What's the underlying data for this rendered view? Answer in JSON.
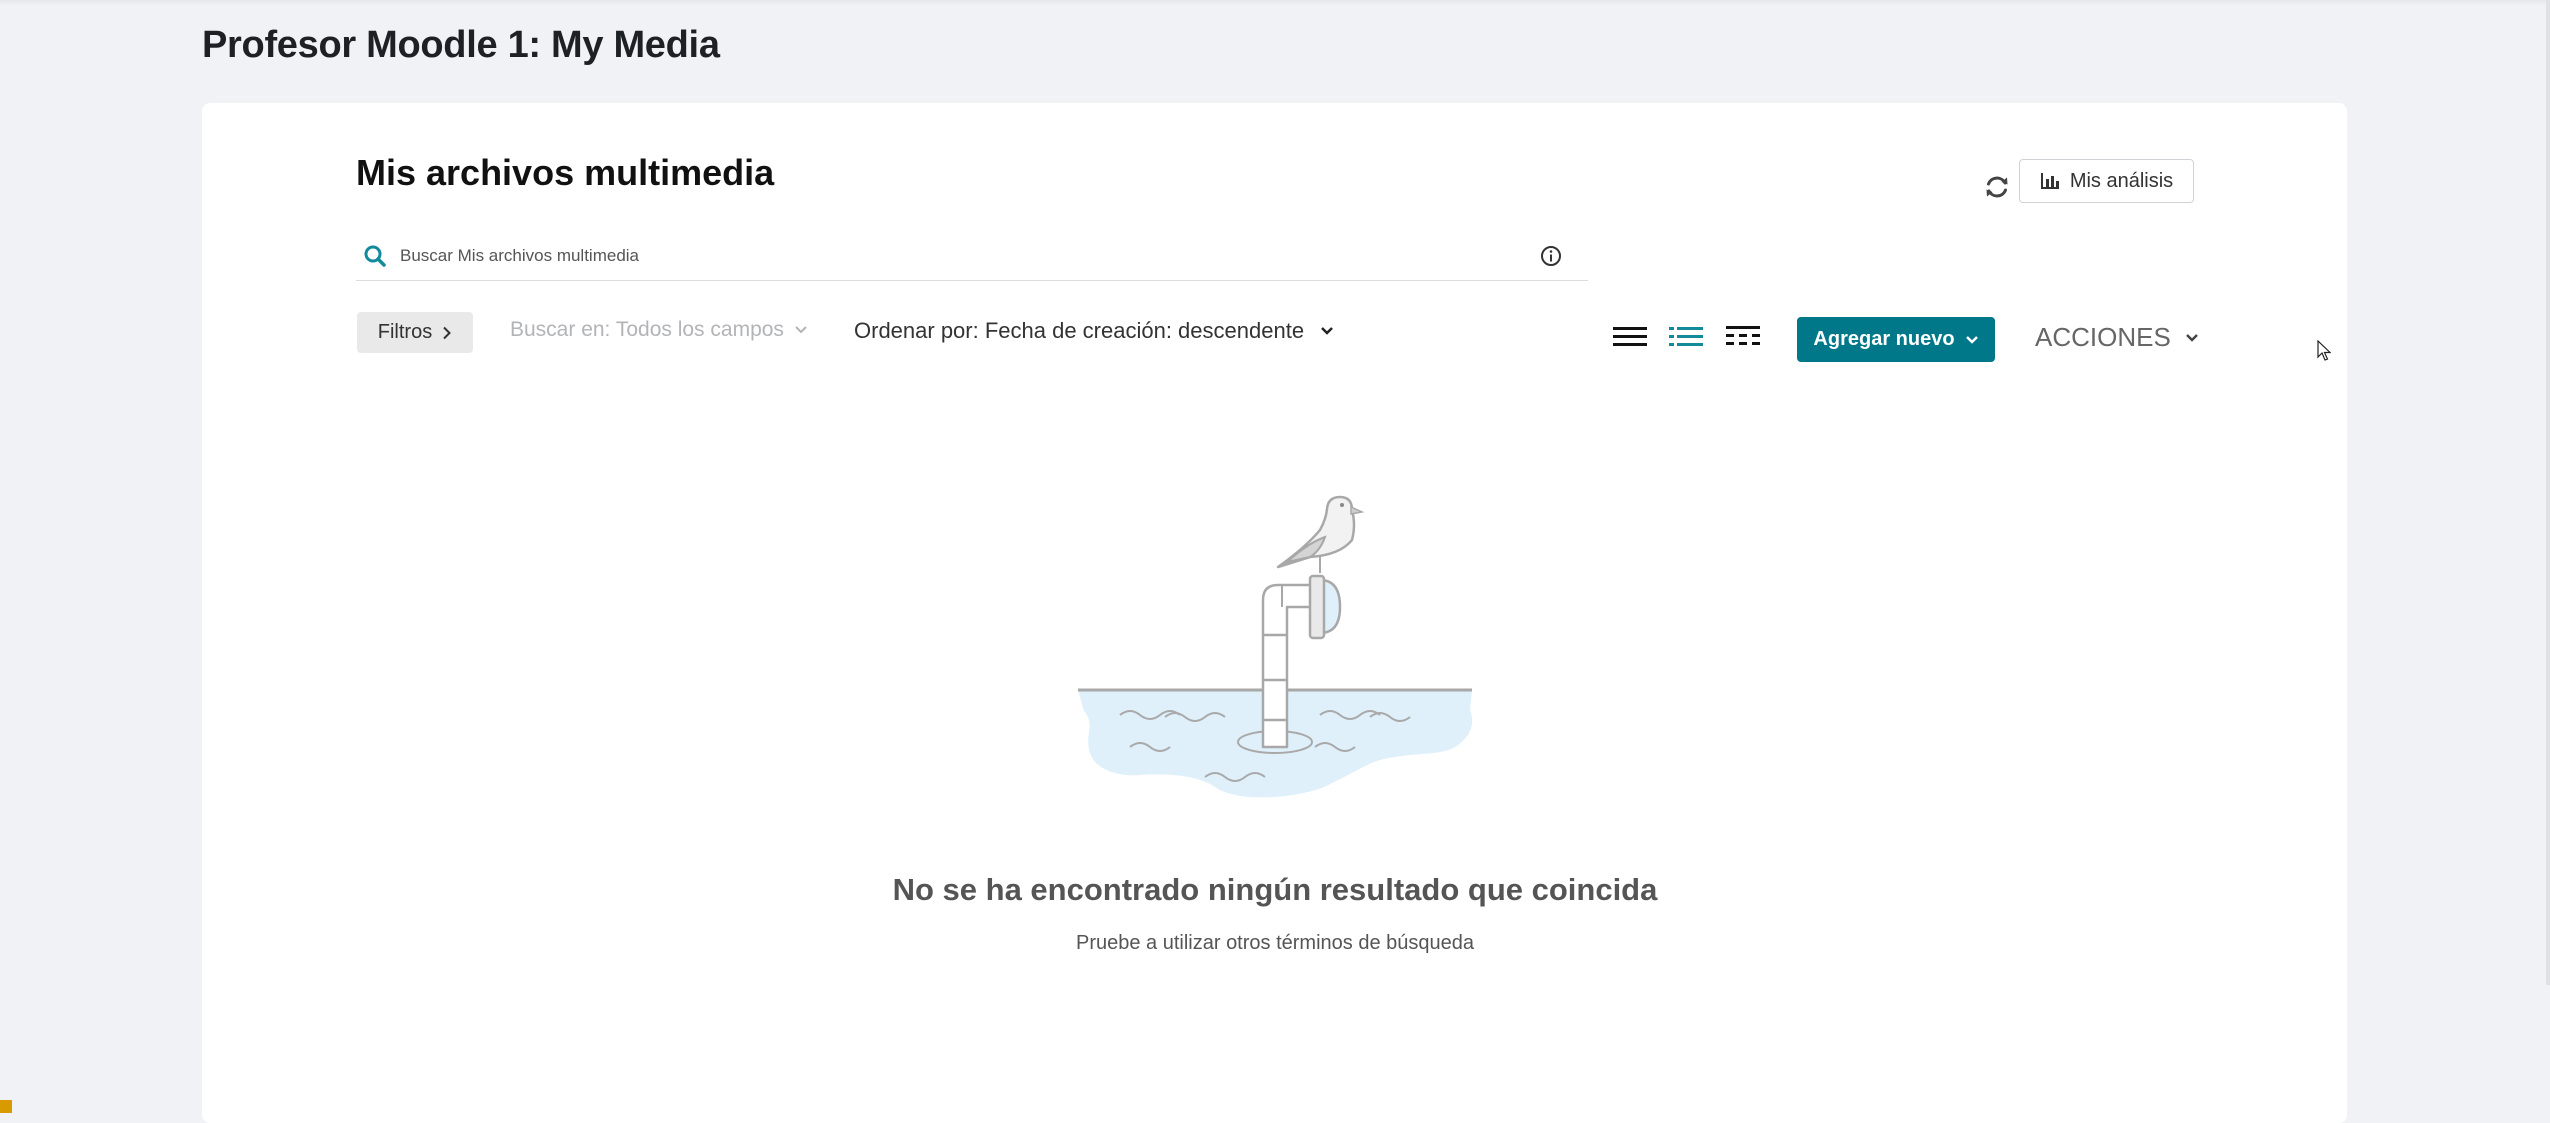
{
  "page": {
    "heading": "Profesor Moodle 1: My Media"
  },
  "media": {
    "title": "Mis archivos multimedia",
    "analytics_label": "Mis análisis",
    "search": {
      "placeholder": "Buscar Mis archivos multimedia",
      "value": ""
    },
    "toolbar": {
      "filters_label": "Filtros",
      "search_in_label": "Buscar en: Todos los campos",
      "sort_label": "Ordenar por: Fecha de creación: descendente",
      "add_new_label": "Agregar nuevo",
      "actions_label": "ACCIONES",
      "view_modes": [
        "detailed-view-icon",
        "list-view-icon",
        "grid-view-icon"
      ],
      "active_view": "list-view-icon"
    },
    "empty_state": {
      "title": "No se ha encontrado ningún resultado que coincida",
      "subtitle": "Pruebe a utilizar otros términos de búsqueda"
    }
  },
  "colors": {
    "accent": "#00788a",
    "search_icon": "#138a9a",
    "background": "#f1f2f5",
    "water": "#dff0fb",
    "corner_mark": "#d99a00"
  }
}
